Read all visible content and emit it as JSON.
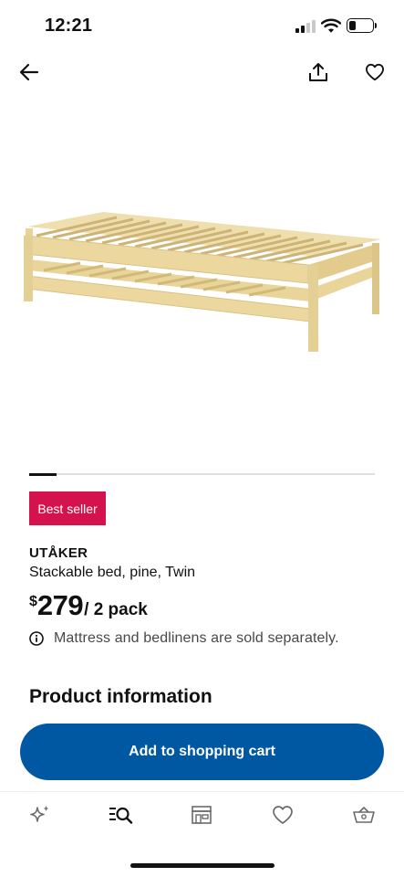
{
  "status_bar": {
    "time": "12:21",
    "icons": [
      "cellular-signal-icon",
      "wifi-icon",
      "battery-icon"
    ],
    "battery_level": 0.3
  },
  "top_nav": {
    "icons": [
      "back-arrow-icon",
      "share-icon",
      "heart-icon"
    ]
  },
  "product": {
    "image_icon": "stackable-bed-image",
    "carousel_progress": 0.08,
    "badge": "Best seller",
    "name": "UTÅKER",
    "description": "Stackable bed, pine, Twin",
    "price": {
      "currency": "$",
      "amount": "279",
      "unit": "/ 2 pack"
    },
    "notice": {
      "icon": "info-icon",
      "text": "Mattress and bedlinens are sold separately."
    }
  },
  "sections": {
    "product_information": "Product information"
  },
  "actions": {
    "add_to_cart": "Add to shopping cart"
  },
  "tab_bar": {
    "items": [
      "sparkle-icon",
      "search-list-icon",
      "store-icon",
      "heart-icon",
      "basket-icon"
    ],
    "active_index": 1
  },
  "colors": {
    "accent": "#0058a3",
    "badge": "#d4124e",
    "text": "#111111",
    "muted_text": "#484848"
  }
}
